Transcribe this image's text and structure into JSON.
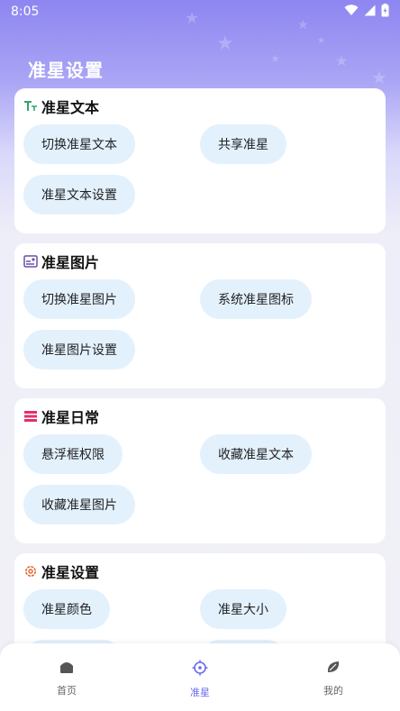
{
  "status_bar": {
    "time": "8:05"
  },
  "page": {
    "title": "准星设置"
  },
  "cards": [
    {
      "title": "准星文本",
      "buttons": [
        "切换准星文本",
        "共享准星",
        "准星文本设置"
      ]
    },
    {
      "title": "准星图片",
      "buttons": [
        "切换准星图片",
        "系统准星图标",
        "准星图片设置"
      ]
    },
    {
      "title": "准星日常",
      "buttons": [
        "悬浮框权限",
        "收藏准星文本",
        "收藏准星图片"
      ]
    },
    {
      "title": "准星设置",
      "buttons": [
        "准星颜色",
        "准星大小"
      ]
    }
  ],
  "bottom_nav": {
    "items": [
      {
        "label": "首页",
        "icon": "home-icon",
        "active": false
      },
      {
        "label": "准星",
        "icon": "crosshair-icon",
        "active": true
      },
      {
        "label": "我的",
        "icon": "leaf-icon",
        "active": false
      }
    ]
  },
  "colors": {
    "header_gradient_top": "#8e86f1",
    "pill_bg": "#e3f1fd",
    "accent": "#6a6ce8",
    "text_icon_green": "#2ea86b",
    "image_icon_purple": "#6b4fa8",
    "daily_icon_pink": "#e2306c",
    "settings_icon_orange": "#e0632a"
  }
}
